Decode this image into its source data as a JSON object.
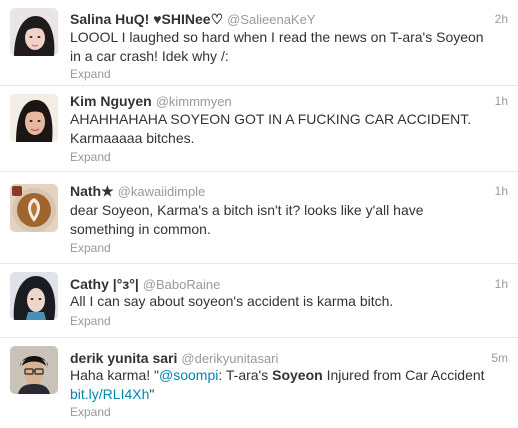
{
  "tweets": [
    {
      "fullname": "Salina HuQ! ♥SHINee♡",
      "username": "@SalieenaKeY",
      "time": "2h",
      "text": "LOOOL I laughed so hard when I read the news on T-ara's Soyeon in a car crash! Idek why /:",
      "expand": "Expand",
      "avatar": "girl-photo-avatar"
    },
    {
      "fullname": "Kim Nguyen",
      "username": "@kimmmyen",
      "time": "1h",
      "text": "AHAHHAHAHA SOYEON GOT IN A FUCKING CAR ACCIDENT. Karmaaaaa bitches.",
      "expand": "Expand",
      "avatar": "girl-photo-avatar"
    },
    {
      "fullname": "Nath★",
      "username": "@kawaiidimple",
      "time": "1h",
      "text": "dear Soyeon, Karma's a bitch isn't it? looks like y'all have something in common.",
      "expand": "Expand",
      "avatar": "latte-art-avatar"
    },
    {
      "fullname": "Cathy |°з°|",
      "username": "@BaboRaine",
      "time": "1h",
      "text": "All I can say about soyeon's accident is karma bitch.",
      "expand": "Expand",
      "avatar": "girl-photo-avatar"
    },
    {
      "fullname": "derik yunita sari",
      "username": "@derikyunitasari",
      "time": "5m",
      "text_parts": {
        "p1": "Haha karma! \"",
        "mention": "@soompi",
        "p2": ": T-ara's ",
        "bold": "Soyeon",
        "p3": " Injured from Car Accident ",
        "url": "bit.ly/RLI4Xh",
        "p4": "\""
      },
      "expand": "Expand",
      "avatar": "man-photo-avatar"
    }
  ],
  "colors": {
    "link": "#0084b4",
    "meta": "#999999",
    "text": "#333333",
    "divider": "#e8e8e8"
  }
}
